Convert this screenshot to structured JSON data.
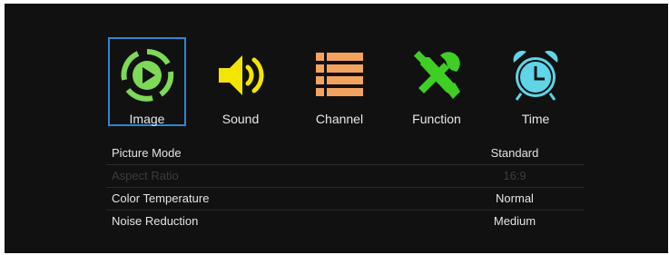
{
  "menu": {
    "tabs": [
      {
        "label": "Image",
        "icon": "play-circle-icon",
        "color": "#7ed957",
        "selected": true
      },
      {
        "label": "Sound",
        "icon": "speaker-icon",
        "color": "#f2e600",
        "selected": false
      },
      {
        "label": "Channel",
        "icon": "list-icon",
        "color": "#f4a35f",
        "selected": false
      },
      {
        "label": "Function",
        "icon": "tools-icon",
        "color": "#3fcf24",
        "selected": false
      },
      {
        "label": "Time",
        "icon": "alarm-clock-icon",
        "color": "#5fd5e8",
        "selected": false
      }
    ],
    "selection_color": "#2f86cf"
  },
  "settings": {
    "rows": [
      {
        "name": "Picture Mode",
        "value": "Standard",
        "enabled": true
      },
      {
        "name": "Aspect Ratio",
        "value": "16:9",
        "enabled": false
      },
      {
        "name": "Color Temperature",
        "value": "Normal",
        "enabled": true
      },
      {
        "name": "Noise Reduction",
        "value": "Medium",
        "enabled": true
      }
    ]
  }
}
